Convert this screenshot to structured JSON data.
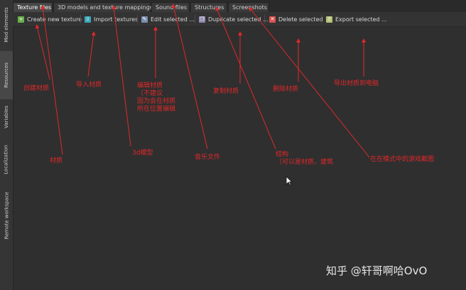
{
  "sidebar": {
    "items": [
      {
        "label": "Mod elements",
        "active": false
      },
      {
        "label": "Resources",
        "active": true
      },
      {
        "label": "Variables",
        "active": false
      },
      {
        "label": "Localization",
        "active": false
      },
      {
        "label": "Remote workspace",
        "active": false
      }
    ]
  },
  "tabs": [
    {
      "label": "Texture files",
      "active": true
    },
    {
      "label": "3D models and texture mappings",
      "active": false
    },
    {
      "label": "Sound files",
      "active": false
    },
    {
      "label": "Structures",
      "active": false
    },
    {
      "label": "Screenshots",
      "active": false
    }
  ],
  "toolbar": {
    "create": {
      "label": "Create new texture",
      "icon": "plus-icon",
      "color": "#6ab04c"
    },
    "import": {
      "label": "Import textures",
      "icon": "import-icon",
      "color": "#3aa7b8"
    },
    "edit": {
      "label": "Edit selected ...",
      "icon": "edit-icon",
      "color": "#7a8fb0"
    },
    "duplicate": {
      "label": "Duplicate selected ...",
      "icon": "duplicate-icon",
      "color": "#8f8ab0"
    },
    "delete": {
      "label": "Delete selected",
      "icon": "delete-icon",
      "color": "#d9534f"
    },
    "export": {
      "label": "Export selected ...",
      "icon": "export-icon",
      "color": "#b8c27a"
    }
  },
  "annotations": {
    "create": "创建材质",
    "import": "导入材质",
    "edit_1": "编辑材质",
    "edit_2": "（不建议",
    "edit_3": "因为会在材质",
    "edit_4": "所在位置编辑",
    "duplicate": "复制材质",
    "delete": "删除材质",
    "export": "导出材质到电脑",
    "texture": "材质",
    "model": "3d模型",
    "sound": "音乐文件",
    "structure_1": "结构",
    "structure_2": "（可以是材质，建筑",
    "screenshot": "在在模式中的游戏截图"
  },
  "watermark": "知乎 @轩哥啊哈OvO",
  "colors": {
    "annotation": "#e0282a",
    "background": "#2f2f2f"
  }
}
